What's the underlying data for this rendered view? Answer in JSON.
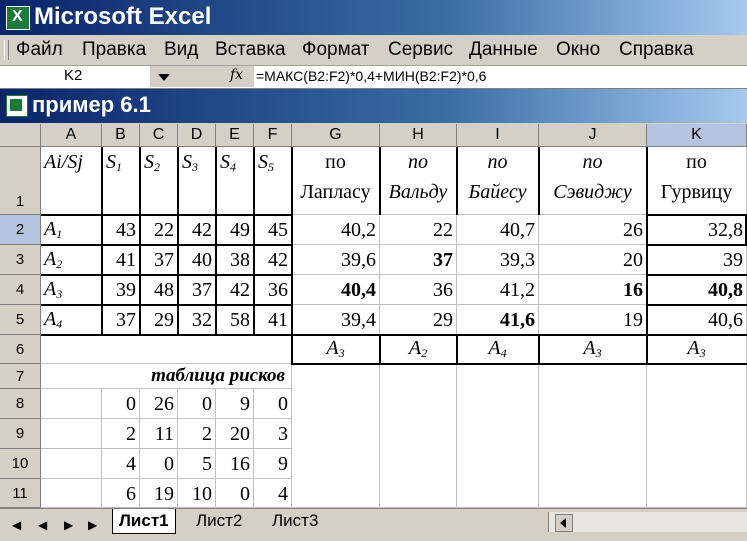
{
  "app": {
    "title": "Microsoft Excel"
  },
  "menu": [
    "Файл",
    "Правка",
    "Вид",
    "Вставка",
    "Формат",
    "Сервис",
    "Данные",
    "Окно",
    "Справка"
  ],
  "formula_bar": {
    "name_box": "K2",
    "fx": "fx",
    "formula": "=МАКС(B2:F2)*0,4+МИН(B2:F2)*0,6"
  },
  "workbook": {
    "title": "пример 6.1"
  },
  "columns": [
    "A",
    "B",
    "C",
    "D",
    "E",
    "F",
    "G",
    "H",
    "I",
    "J",
    "K"
  ],
  "rows": [
    "1",
    "2",
    "3",
    "4",
    "5",
    "6",
    "7",
    "8",
    "9",
    "10",
    "11"
  ],
  "header": {
    "a": "Ai/Sj",
    "s": [
      {
        "l": "S",
        "i": "1"
      },
      {
        "l": "S",
        "i": "2"
      },
      {
        "l": "S",
        "i": "3"
      },
      {
        "l": "S",
        "i": "4"
      },
      {
        "l": "S",
        "i": "5"
      }
    ],
    "criteria": [
      {
        "top": "по",
        "bottom": "Лапласу"
      },
      {
        "top": "по",
        "bottom": "Вальду"
      },
      {
        "top": "по",
        "bottom": "Байесу"
      },
      {
        "top": "по",
        "bottom": "Сэвиджу"
      },
      {
        "top": "по",
        "bottom": "Гурвицу"
      }
    ]
  },
  "alternatives": [
    {
      "l": "A",
      "i": "1",
      "v": [
        "43",
        "22",
        "42",
        "49",
        "45"
      ],
      "r": [
        "40,2",
        "22",
        "40,7",
        "26",
        "32,8"
      ]
    },
    {
      "l": "A",
      "i": "2",
      "v": [
        "41",
        "37",
        "40",
        "38",
        "42"
      ],
      "r": [
        "39,6",
        "37",
        "39,3",
        "20",
        "39"
      ]
    },
    {
      "l": "A",
      "i": "3",
      "v": [
        "39",
        "48",
        "37",
        "42",
        "36"
      ],
      "r": [
        "40,4",
        "36",
        "41,2",
        "16",
        "40,8"
      ]
    },
    {
      "l": "A",
      "i": "4",
      "v": [
        "37",
        "29",
        "32",
        "58",
        "41"
      ],
      "r": [
        "39,4",
        "29",
        "41,6",
        "19",
        "40,6"
      ]
    }
  ],
  "best": [
    {
      "l": "A",
      "i": "3"
    },
    {
      "l": "A",
      "i": "2"
    },
    {
      "l": "A",
      "i": "4"
    },
    {
      "l": "A",
      "i": "3"
    },
    {
      "l": "A",
      "i": "3"
    }
  ],
  "risk_table": {
    "label": "таблица рисков",
    "rows": [
      [
        "0",
        "26",
        "0",
        "9",
        "0"
      ],
      [
        "2",
        "11",
        "2",
        "20",
        "3"
      ],
      [
        "4",
        "0",
        "5",
        "16",
        "9"
      ],
      [
        "6",
        "19",
        "10",
        "0",
        "4"
      ]
    ]
  },
  "sheets": [
    "Лист1",
    "Лист2",
    "Лист3"
  ],
  "nav_icons": [
    "first-sheet-icon",
    "prev-sheet-icon",
    "next-sheet-icon",
    "last-sheet-icon"
  ]
}
